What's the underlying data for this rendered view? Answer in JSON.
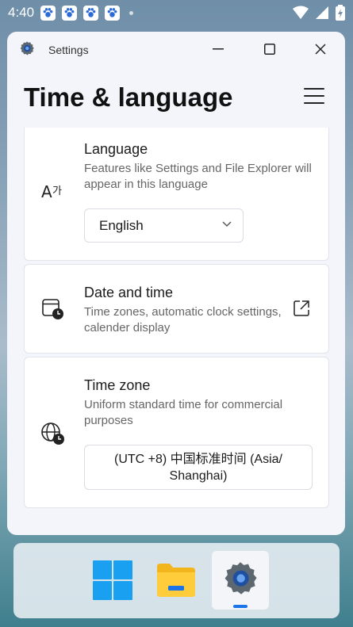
{
  "status_bar": {
    "time": "4:40"
  },
  "window": {
    "app_title": "Settings",
    "page_title": "Time & language"
  },
  "language_card": {
    "title": "Language",
    "description": "Features like Settings and File Explorer will appear in this language",
    "selected_language": "English"
  },
  "date_time_card": {
    "title": "Date and time",
    "description": "Time zones, automatic clock settings, calender display"
  },
  "timezone_card": {
    "title": "Time zone",
    "description": "Uniform standard time for commercial purposes",
    "value": "(UTC +8) 中国标准时间 (Asia/ Shanghai)"
  },
  "colors": {
    "accent": "#1a73e8",
    "window_bg": "#f3f5fa"
  }
}
